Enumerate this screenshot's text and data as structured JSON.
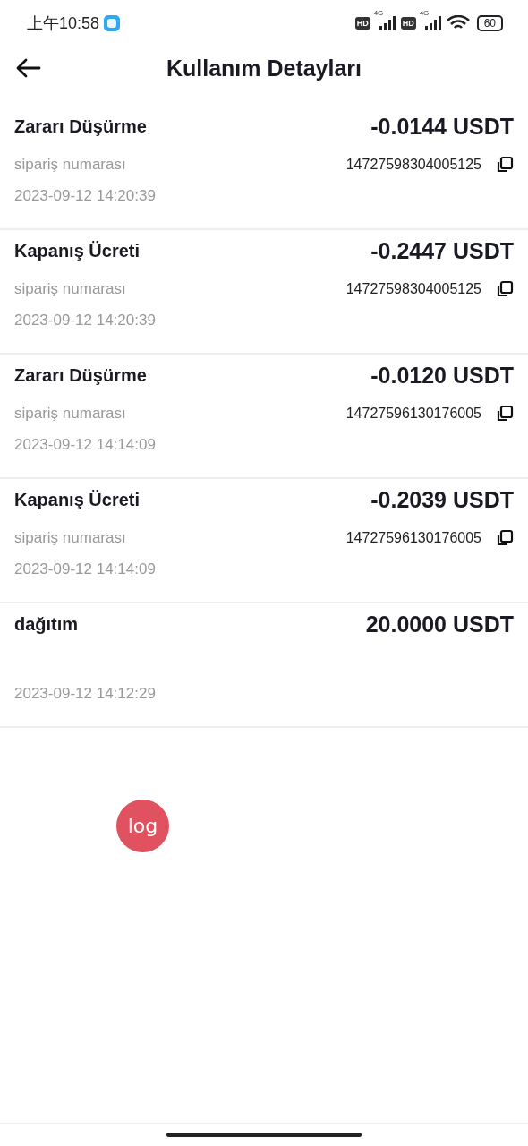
{
  "status_bar": {
    "time": "上午10:58",
    "sims": [
      {
        "badge": "HD",
        "network": "4G"
      },
      {
        "badge": "HD",
        "network": "4G"
      }
    ],
    "battery": "60"
  },
  "header": {
    "title": "Kullanım Detayları"
  },
  "entries": [
    {
      "title": "Zararı Düşürme",
      "amount": "-0.0144 USDT",
      "order_label": "sipariş numarası",
      "order_number": "14727598304005125",
      "time": "2023-09-12 14:20:39"
    },
    {
      "title": "Kapanış Ücreti",
      "amount": "-0.2447 USDT",
      "order_label": "sipariş numarası",
      "order_number": "14727598304005125",
      "time": "2023-09-12 14:20:39"
    },
    {
      "title": "Zararı Düşürme",
      "amount": "-0.0120 USDT",
      "order_label": "sipariş numarası",
      "order_number": "14727596130176005",
      "time": "2023-09-12 14:14:09"
    },
    {
      "title": "Kapanış Ücreti",
      "amount": "-0.2039 USDT",
      "order_label": "sipariş numarası",
      "order_number": "14727596130176005",
      "time": "2023-09-12 14:14:09"
    },
    {
      "title": "dağıtım",
      "amount": "20.0000 USDT",
      "time": "2023-09-12 14:12:29"
    }
  ],
  "floating_button": {
    "label": "log"
  }
}
